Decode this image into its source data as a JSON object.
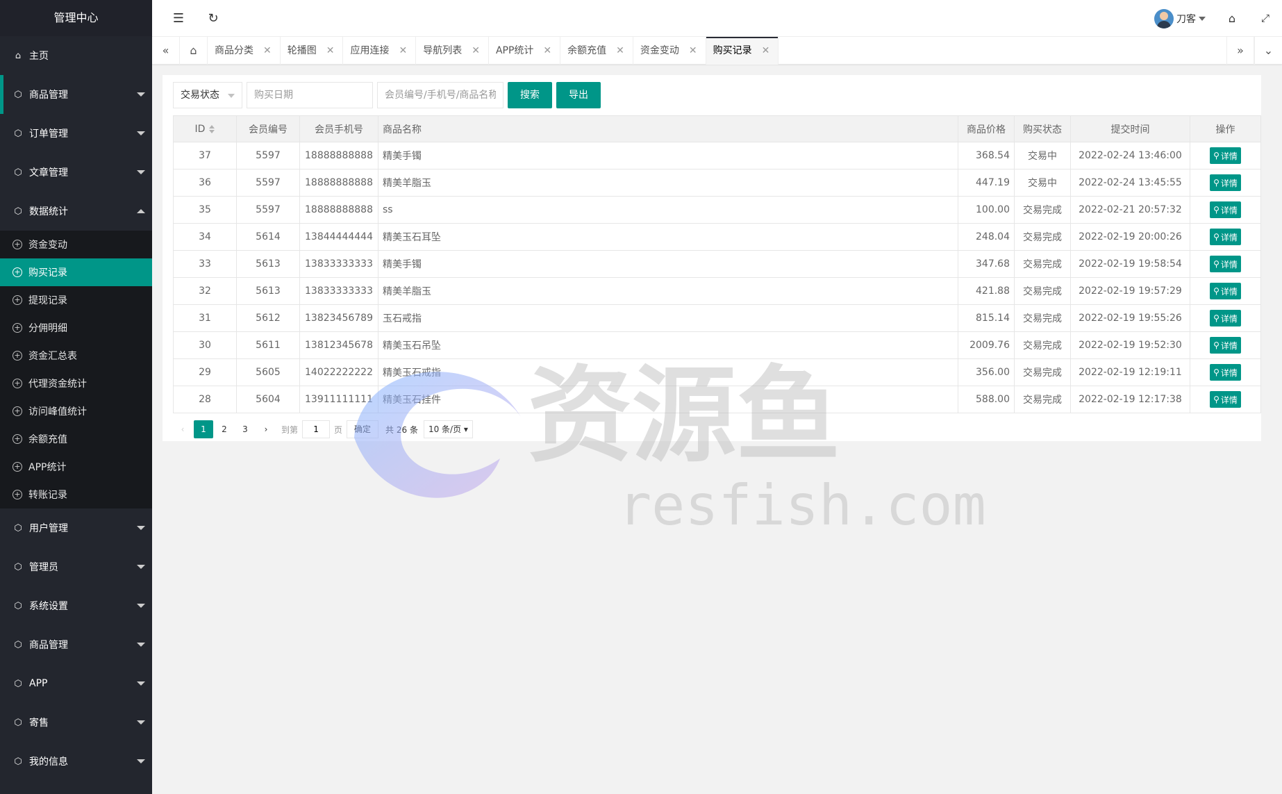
{
  "sidebar": {
    "title": "管理中心",
    "home": "主页",
    "groups_top": [
      {
        "label": "商品管理"
      },
      {
        "label": "订单管理"
      },
      {
        "label": "文章管理"
      },
      {
        "label": "数据统计"
      }
    ],
    "sub_items": [
      "资金变动",
      "购买记录",
      "提现记录",
      "分佣明细",
      "资金汇总表",
      "代理资金统计",
      "访问峰值统计",
      "余额充值",
      "APP统计",
      "转账记录"
    ],
    "groups_bottom": [
      {
        "label": "用户管理"
      },
      {
        "label": "管理员"
      },
      {
        "label": "系统设置"
      },
      {
        "label": "商品管理"
      },
      {
        "label": "APP"
      },
      {
        "label": "寄售"
      },
      {
        "label": "我的信息"
      }
    ]
  },
  "header": {
    "user_name": "刀客"
  },
  "tabs": [
    "商品分类",
    "轮播图",
    "应用连接",
    "导航列表",
    "APP统计",
    "余额充值",
    "资金变动",
    "购买记录"
  ],
  "filter": {
    "status_select": "交易状态",
    "date_placeholder": "购买日期",
    "keyword_placeholder": "会员编号/手机号/商品名称",
    "search_label": "搜索",
    "export_label": "导出"
  },
  "table": {
    "headers": {
      "id": "ID",
      "member": "会员编号",
      "phone": "会员手机号",
      "name": "商品名称",
      "price": "商品价格",
      "status": "购买状态",
      "time": "提交时间",
      "action": "操作"
    },
    "detail_label": "详情",
    "rows": [
      {
        "id": "37",
        "member": "5597",
        "phone": "18888888888",
        "name": "精美手镯",
        "price": "368.54",
        "status": "交易中",
        "time": "2022-02-24 13:46:00"
      },
      {
        "id": "36",
        "member": "5597",
        "phone": "18888888888",
        "name": "精美羊脂玉",
        "price": "447.19",
        "status": "交易中",
        "time": "2022-02-24 13:45:55"
      },
      {
        "id": "35",
        "member": "5597",
        "phone": "18888888888",
        "name": "ss",
        "price": "100.00",
        "status": "交易完成",
        "time": "2022-02-21 20:57:32"
      },
      {
        "id": "34",
        "member": "5614",
        "phone": "13844444444",
        "name": "精美玉石耳坠",
        "price": "248.04",
        "status": "交易完成",
        "time": "2022-02-19 20:00:26"
      },
      {
        "id": "33",
        "member": "5613",
        "phone": "13833333333",
        "name": "精美手镯",
        "price": "347.68",
        "status": "交易完成",
        "time": "2022-02-19 19:58:54"
      },
      {
        "id": "32",
        "member": "5613",
        "phone": "13833333333",
        "name": "精美羊脂玉",
        "price": "421.88",
        "status": "交易完成",
        "time": "2022-02-19 19:57:29"
      },
      {
        "id": "31",
        "member": "5612",
        "phone": "13823456789",
        "name": "玉石戒指",
        "price": "815.14",
        "status": "交易完成",
        "time": "2022-02-19 19:55:26"
      },
      {
        "id": "30",
        "member": "5611",
        "phone": "13812345678",
        "name": "精美玉石吊坠",
        "price": "2009.76",
        "status": "交易完成",
        "time": "2022-02-19 19:52:30"
      },
      {
        "id": "29",
        "member": "5605",
        "phone": "14022222222",
        "name": "精美玉石戒指",
        "price": "356.00",
        "status": "交易完成",
        "time": "2022-02-19 12:19:11"
      },
      {
        "id": "28",
        "member": "5604",
        "phone": "13911111111",
        "name": "精美玉石挂件",
        "price": "588.00",
        "status": "交易完成",
        "time": "2022-02-19 12:17:38"
      }
    ]
  },
  "pagination": {
    "pages": [
      "1",
      "2",
      "3"
    ],
    "current": "1",
    "goto_label": "到第",
    "goto_value": "1",
    "page_unit": "页",
    "confirm_label": "确定",
    "total": "共 26 条",
    "limit": "10 条/页"
  },
  "watermark": {
    "cn": "资源鱼",
    "en": "resfish.com"
  },
  "colors": {
    "accent": "#009688",
    "sidebar_bg": "#23262e",
    "sidebar_sub_bg": "#17191d"
  }
}
